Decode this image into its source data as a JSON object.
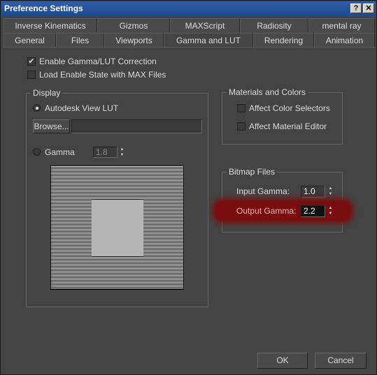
{
  "window": {
    "title": "Preference Settings",
    "help_glyph": "?",
    "close_glyph": "✕"
  },
  "tabs_row1": [
    "Inverse Kinematics",
    "Gizmos",
    "MAXScript",
    "Radiosity",
    "mental ray"
  ],
  "tabs_row2": [
    "General",
    "Files",
    "Viewports",
    "Gamma and LUT",
    "Rendering",
    "Animation"
  ],
  "active_tab": "Gamma and LUT",
  "options": {
    "enable_gamma": {
      "label": "Enable Gamma/LUT Correction",
      "checked": true
    },
    "load_state": {
      "label": "Load Enable State with MAX Files",
      "checked": false
    }
  },
  "display": {
    "title": "Display",
    "lut_label": "Autodesk View LUT",
    "browse_label": "Browse...",
    "browse_value": "",
    "gamma_label": "Gamma",
    "gamma_value": "1.8"
  },
  "materials": {
    "title": "Materials and Colors",
    "affect_color": "Affect Color Selectors",
    "affect_material": "Affect Material Editor"
  },
  "bitmap": {
    "title": "Bitmap Files",
    "input_label": "Input Gamma:",
    "input_value": "1.0",
    "output_label": "Output Gamma:",
    "output_value": "2.2"
  },
  "buttons": {
    "ok": "OK",
    "cancel": "Cancel"
  },
  "colors": {
    "title_bar": "#1e4a8e",
    "highlight": "#7a0e0e",
    "background": "#444444"
  }
}
